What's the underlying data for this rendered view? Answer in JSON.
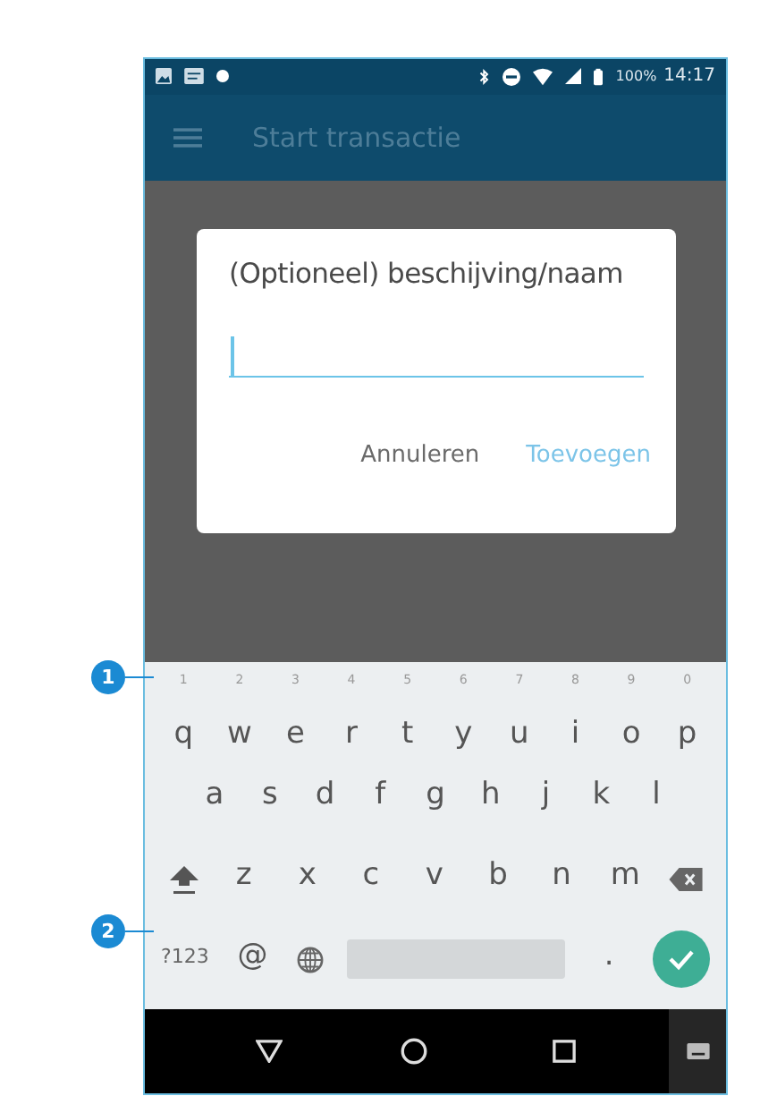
{
  "status_bar": {
    "battery": "100%",
    "time": "14:17"
  },
  "app_bar": {
    "title": "Start transactie"
  },
  "dialog": {
    "title": "(Optioneel) beschijving/naam",
    "buttons": [
      {
        "label": "Annuleren",
        "kind": "neutral"
      },
      {
        "label": "Toevoegen",
        "kind": "primary"
      }
    ]
  },
  "keyboard": {
    "rows": [
      [
        {
          "kind": "key",
          "label": "q",
          "hint": "1"
        },
        {
          "kind": "key",
          "label": "w",
          "hint": "2"
        },
        {
          "kind": "key",
          "label": "e",
          "hint": "3"
        },
        {
          "kind": "key",
          "label": "r",
          "hint": "4"
        },
        {
          "kind": "key",
          "label": "t",
          "hint": "5"
        },
        {
          "kind": "key",
          "label": "y",
          "hint": "6"
        },
        {
          "kind": "key",
          "label": "u",
          "hint": "7"
        },
        {
          "kind": "key",
          "label": "i",
          "hint": "8"
        },
        {
          "kind": "key",
          "label": "o",
          "hint": "9"
        },
        {
          "kind": "key",
          "label": "p",
          "hint": "0"
        }
      ],
      [
        {
          "kind": "key",
          "label": "a"
        },
        {
          "kind": "key",
          "label": "s"
        },
        {
          "kind": "key",
          "label": "d"
        },
        {
          "kind": "key",
          "label": "f"
        },
        {
          "kind": "key",
          "label": "g"
        },
        {
          "kind": "key",
          "label": "h"
        },
        {
          "kind": "key",
          "label": "j"
        },
        {
          "kind": "key",
          "label": "k"
        },
        {
          "kind": "key",
          "label": "l"
        }
      ],
      [
        {
          "kind": "shift"
        },
        {
          "kind": "key",
          "label": "z"
        },
        {
          "kind": "key",
          "label": "x"
        },
        {
          "kind": "key",
          "label": "c"
        },
        {
          "kind": "key",
          "label": "v"
        },
        {
          "kind": "key",
          "label": "b"
        },
        {
          "kind": "key",
          "label": "n"
        },
        {
          "kind": "key",
          "label": "m"
        },
        {
          "kind": "backspace"
        }
      ],
      [
        {
          "kind": "key",
          "label": "?123"
        },
        {
          "kind": "key",
          "label": "@"
        },
        {
          "kind": "globe"
        },
        {
          "kind": "space"
        },
        {
          "kind": "key",
          "label": "."
        },
        {
          "kind": "enter"
        }
      ]
    ]
  },
  "callouts": [
    {
      "number": "1"
    },
    {
      "number": "2"
    }
  ]
}
